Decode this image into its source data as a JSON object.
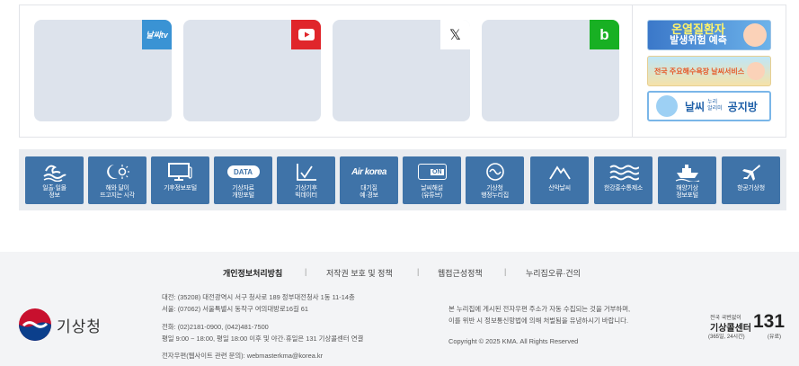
{
  "sns": {
    "cards": [
      {
        "id": "weather-tv",
        "badge_text": "날씨tv",
        "color": "#3a93d4"
      },
      {
        "id": "youtube",
        "badge_text": "",
        "color": "#e0262b"
      },
      {
        "id": "x",
        "badge_text": "𝕏",
        "color": "#ffffff"
      },
      {
        "id": "blog",
        "badge_text": "b",
        "color": "#18b023"
      }
    ],
    "banners": [
      {
        "line1": "온열질환자",
        "line2": "발생위험 예측"
      },
      {
        "line1": "전국 주요해수욕장 날씨서비스",
        "line2": ""
      },
      {
        "line1": "날씨",
        "small": "누리\n알리미",
        "line2": "공지방"
      }
    ]
  },
  "quick_links": [
    {
      "icon": "wave-icon",
      "label": "일출·일몰\n정보"
    },
    {
      "icon": "moon-sun-icon",
      "label": "해와 달이\n뜨고지는 시각"
    },
    {
      "icon": "monitor-icon",
      "label": "기후정보포털"
    },
    {
      "icon": "data-icon",
      "label": "기상자료\n개방포털",
      "icon_text": "DATA"
    },
    {
      "icon": "chart-icon",
      "label": "기상기후\n빅데이터"
    },
    {
      "icon": "airkorea-icon",
      "label": "대기질\n예·경보",
      "icon_text": "Air korea"
    },
    {
      "icon": "tv-on-icon",
      "label": "날씨해설\n(유튜브)",
      "icon_text": "ON"
    },
    {
      "icon": "swirl-icon",
      "label": "기상청\n행정누리집"
    },
    {
      "icon": "mountain-icon",
      "label": "산악날씨"
    },
    {
      "icon": "river-icon",
      "label": "한강홍수통제소"
    },
    {
      "icon": "ship-icon",
      "label": "해양기상\n정보포털"
    },
    {
      "icon": "airplane-icon",
      "label": "항공기상청"
    }
  ],
  "footer": {
    "nav": [
      "개인정보처리방침",
      "저작권 보호 및 정책",
      "웹접근성정책",
      "누리집오류·건의"
    ],
    "logo_text": "기상청",
    "address_daejeon": "대전: (35208) 대전광역시 서구 청사로 189 정부대전청사 1동 11-14층",
    "address_seoul": "서울: (07062) 서울특별시 동작구 여의대방로16길 61",
    "phone": "전화: (02)2181-0900, (042)481-7500",
    "hours": "평일 9:00 ~ 18:00, 평일 18:00 이후 및 야간·휴일은 131 기상콜센터 연결",
    "email": "전자우편(웹사이트 관련 문의): webmasterkma@korea.kr",
    "notice1": "본 누리집에 게시된 전자우편 주소가 자동 수집되는 것을 거부하며,",
    "notice2": "이를 위반 시 정보통신망법에 의해 처벌됨을 유념하시기 바랍니다.",
    "copyright": "Copyright © 2025 KMA. All Rights Reserved",
    "call_top": "전국 국번없이",
    "call_name": "기상콜센터",
    "call_number": "131",
    "call_sub": "(365일, 24시간)",
    "call_paid": "(유료)"
  },
  "colors": {
    "quick_bg": "#3f73a8",
    "footer_bg": "#f3f4f6",
    "card_bg": "#dde3ec"
  }
}
